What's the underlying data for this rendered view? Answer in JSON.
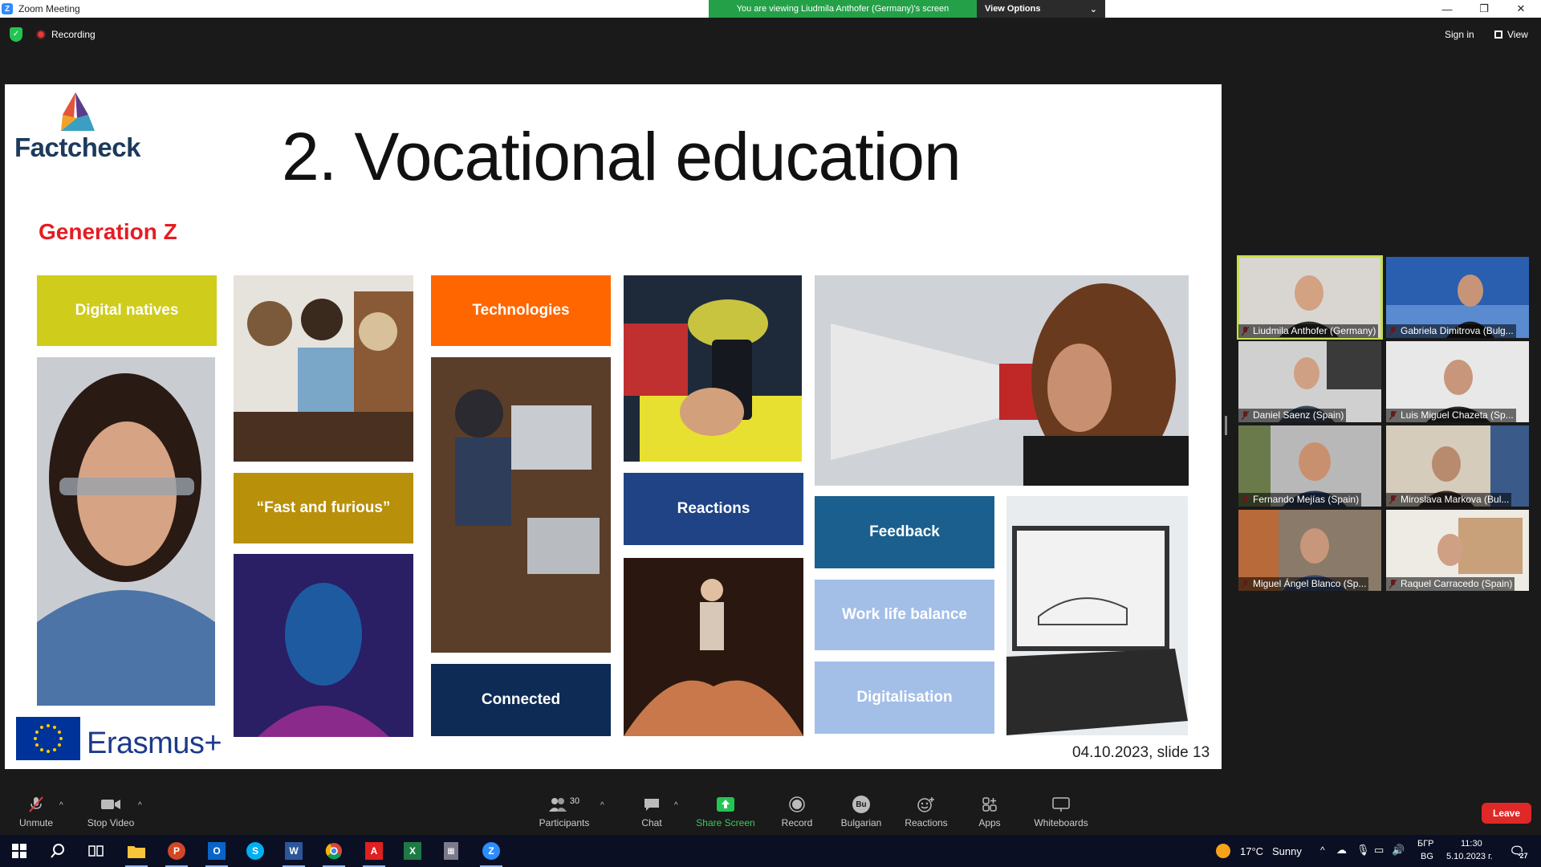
{
  "window": {
    "title": "Zoom Meeting",
    "viewing_message": "You are viewing Liudmila Anthofer (Germany)'s screen",
    "view_options_label": "View Options"
  },
  "topbar": {
    "recording_label": "Recording",
    "signin_label": "Sign in",
    "view_label": "View"
  },
  "slide": {
    "logo_text": "Factcheck",
    "title": "2. Vocational education",
    "subtitle": "Generation Z",
    "tiles": {
      "digital_natives": "Digital natives",
      "fast_furious": "“Fast and furious”",
      "technologies": "Technologies",
      "connected": "Connected",
      "reactions": "Reactions",
      "feedback": "Feedback",
      "work_life": "Work life balance",
      "digitalisation": "Digitalisation"
    },
    "footer_brand": "Erasmus+",
    "footer_date": "04.10.2023, slide 13",
    "colors": {
      "yellow_green": "#cfcc1c",
      "gold": "#b8900a",
      "orange": "#ff6600",
      "navy": "#0d2b55",
      "blue": "#1f4385",
      "teal_blue": "#1a5f8e",
      "light_blue": "#a3bfe8",
      "title_red": "#e51c23"
    }
  },
  "gallery": {
    "participants": [
      {
        "name": "Liudmila Anthofer (Germany)",
        "active": true
      },
      {
        "name": "Gabriela Dimitrova (Bulg..."
      },
      {
        "name": "Daniel Saenz (Spain)"
      },
      {
        "name": "Luis Miguel Chazeta (Sp..."
      },
      {
        "name": "Fernando Mejías (Spain)"
      },
      {
        "name": "Miroslava Markova (Bul..."
      },
      {
        "name": "Miguel Ángel Blanco (Sp..."
      },
      {
        "name": "Raquel Carracedo (Spain)"
      }
    ]
  },
  "toolbar": {
    "unmute": "Unmute",
    "stop_video": "Stop Video",
    "participants": "Participants",
    "participants_count": "30",
    "chat": "Chat",
    "share_screen": "Share Screen",
    "record": "Record",
    "bulgarian": "Bulgarian",
    "bulgarian_badge": "Bu",
    "reactions": "Reactions",
    "apps": "Apps",
    "whiteboards": "Whiteboards",
    "leave": "Leave"
  },
  "taskbar": {
    "weather_temp": "17°C",
    "weather_desc": "Sunny",
    "lang_top": "БГР",
    "lang_bottom": "BG",
    "time": "11:30",
    "date": "5.10.2023 г.",
    "notifications": "27"
  }
}
